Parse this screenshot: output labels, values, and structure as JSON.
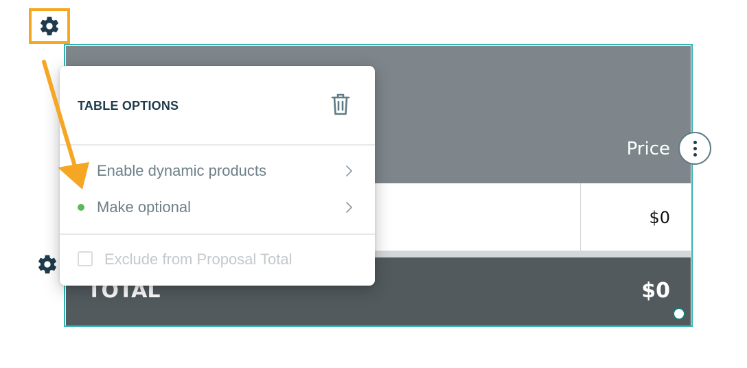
{
  "table_options": {
    "title": "TABLE OPTIONS",
    "items": [
      {
        "label": "Enable dynamic products"
      },
      {
        "label": "Make optional"
      }
    ],
    "exclude_label": "Exclude from Proposal Total",
    "exclude_checked": false
  },
  "pricing_table": {
    "price_header": "Price",
    "row_price": "$0",
    "total_label": "TOTAL",
    "total_value": "$0"
  },
  "icons": {
    "top_gear": "gear-icon",
    "left_gear": "gear-icon",
    "trash": "trash-icon",
    "kebab": "more-vertical-icon",
    "chevron": "chevron-right-icon"
  },
  "colors": {
    "highlight": "#f5a623",
    "table_border": "#2fb3b3",
    "header_bg": "#7e868b",
    "total_bg": "#525a5e",
    "dark_text": "#1f3b4d",
    "active_dot": "#5cb85c"
  }
}
